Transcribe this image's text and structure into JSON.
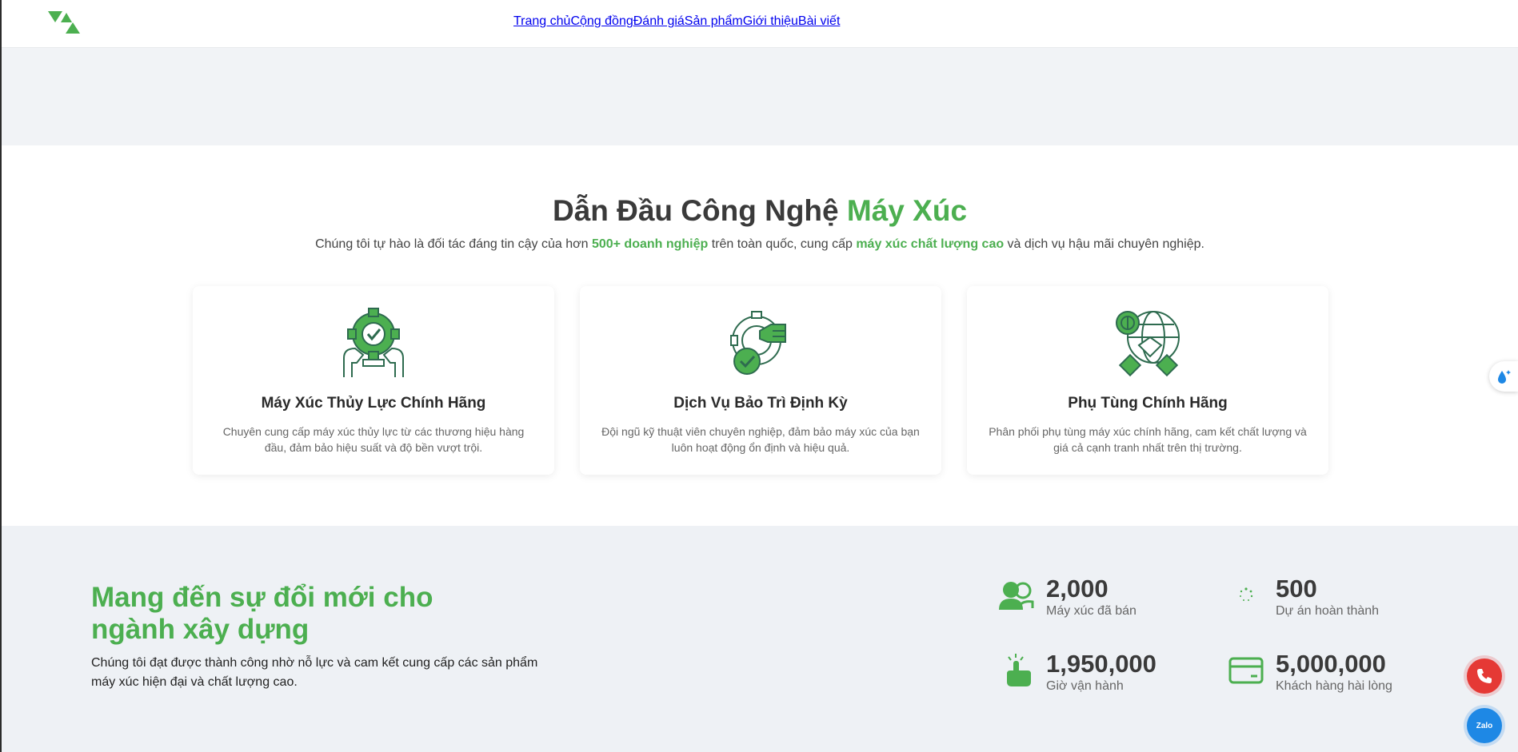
{
  "nav": {
    "items": [
      "Trang chủ",
      "Cộng đồng",
      "Đánh giá",
      "Sản phẩm",
      "Giới thiệu",
      "Bài viết"
    ]
  },
  "hero": {
    "title_main": "Dẫn Đầu Công Nghệ ",
    "title_accent": "Máy Xúc",
    "sub_1": "Chúng tôi tự hào là đối tác đáng tin cậy của hơn ",
    "sub_hl1": "500+ doanh nghiệp",
    "sub_2": " trên toàn quốc, cung cấp ",
    "sub_hl2": "máy xúc chất lượng cao",
    "sub_3": " và dịch vụ hậu mãi chuyên nghiệp."
  },
  "cards": [
    {
      "title": "Máy Xúc Thủy Lực Chính Hãng",
      "desc": "Chuyên cung cấp máy xúc thủy lực từ các thương hiệu hàng đầu, đảm bảo hiệu suất và độ bền vượt trội.",
      "icon": "gear-people-icon"
    },
    {
      "title": "Dịch Vụ Bảo Trì Định Kỳ",
      "desc": "Đội ngũ kỹ thuật viên chuyên nghiệp, đảm bảo máy xúc của bạn luôn hoạt động ổn định và hiệu quả.",
      "icon": "gear-thumbs-up-icon"
    },
    {
      "title": "Phụ Tùng Chính Hãng",
      "desc": "Phân phối phụ tùng máy xúc chính hãng, cam kết chất lượng và giá cả cạnh tranh nhất trên thị trường.",
      "icon": "globe-handshake-icon"
    }
  ],
  "stats": {
    "title": "Mang đến sự đổi mới cho ngành xây dựng",
    "desc": "Chúng tôi đạt được thành công nhờ nỗ lực và cam kết cung cấp các sản phẩm máy xúc hiện đại và chất lượng cao.",
    "items": [
      {
        "value": "2,000",
        "label": "Máy xúc đã bán",
        "icon": "users-icon"
      },
      {
        "value": "500",
        "label": "Dự án hoàn thành",
        "icon": "loading-icon"
      },
      {
        "value": "1,950,000",
        "label": "Giờ vận hành",
        "icon": "hand-tap-icon"
      },
      {
        "value": "5,000,000",
        "label": "Khách hàng hài lòng",
        "icon": "credit-card-icon"
      }
    ]
  },
  "zalo_label": "Zalo",
  "colors": {
    "accent": "#4caf50",
    "phone": "#e53935",
    "zalo": "#1e88e5"
  }
}
